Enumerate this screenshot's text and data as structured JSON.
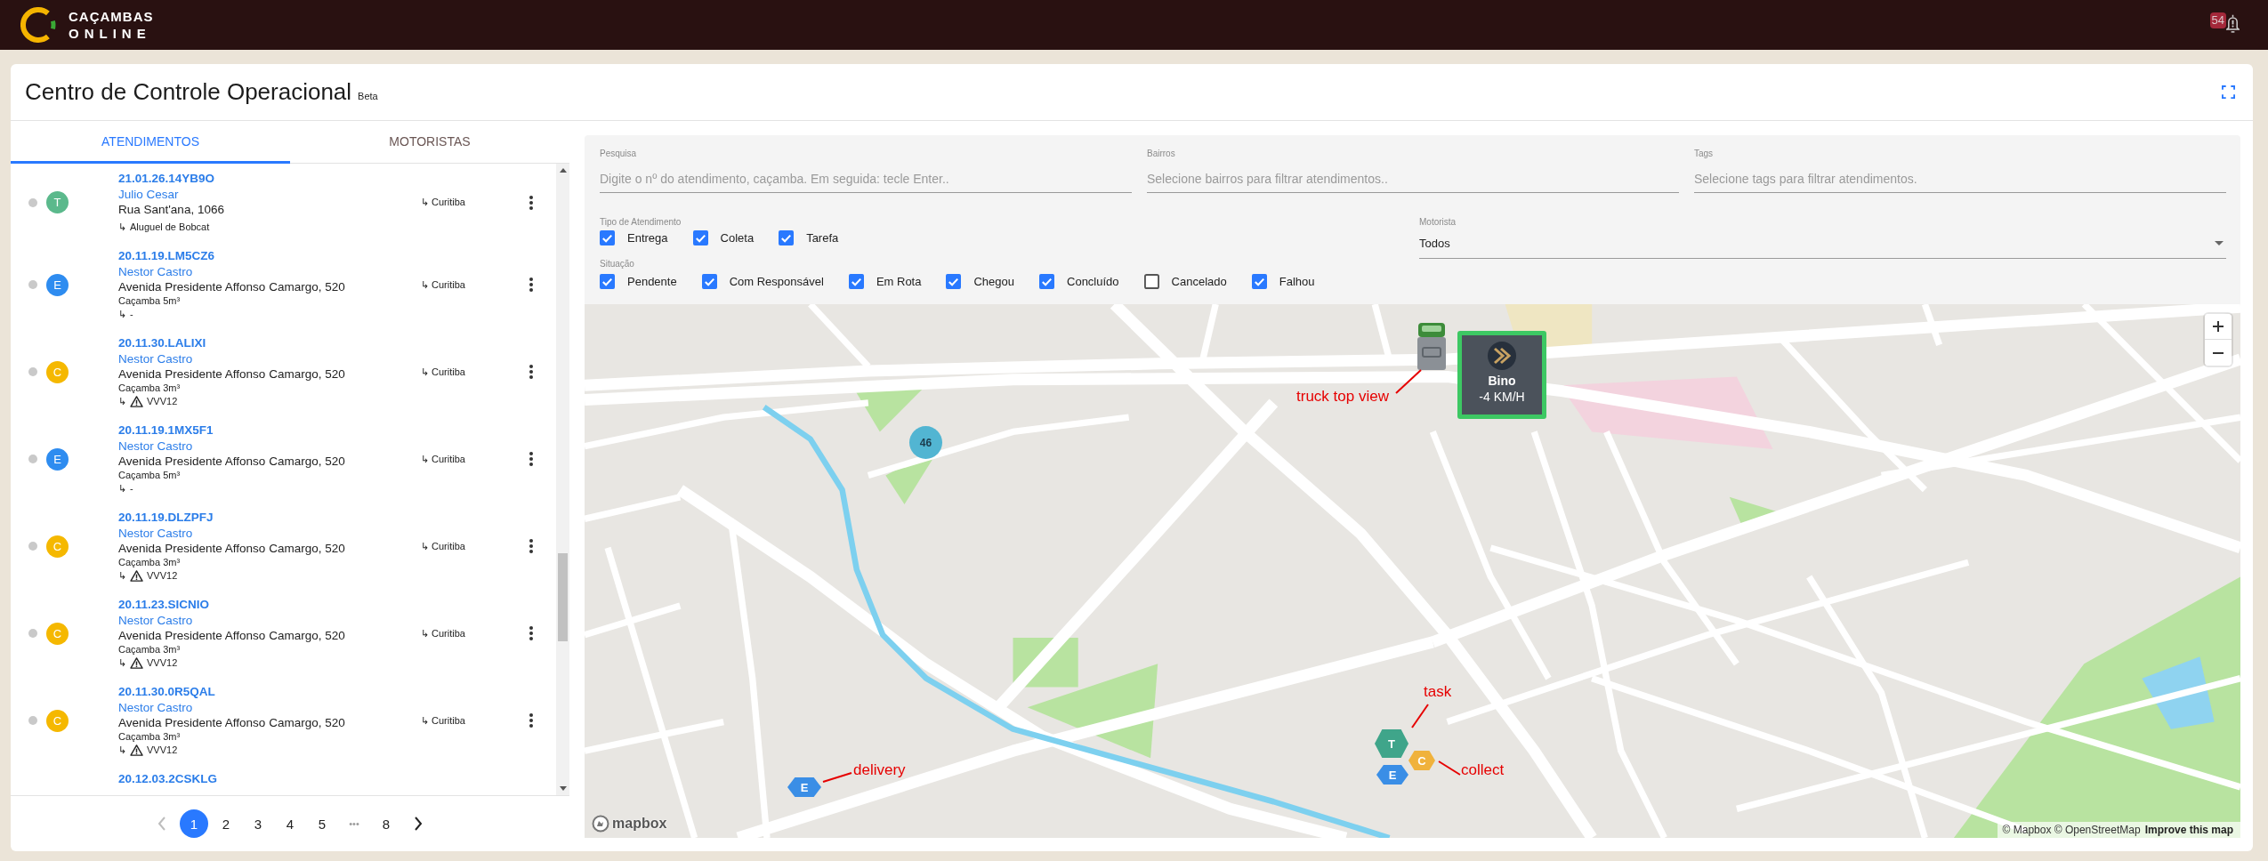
{
  "top_bar": {
    "logo_lines": [
      "CAÇAMBAS",
      "ONLINE"
    ],
    "notification_count": "54"
  },
  "header": {
    "title": "Centro de Controle Operacional",
    "badge": "Beta"
  },
  "left_panel": {
    "tabs": [
      {
        "label": "ATENDIMENTOS",
        "selected": true
      },
      {
        "label": "MOTORISTAS",
        "selected": false
      }
    ],
    "items": [
      {
        "letter": "T",
        "color": "#5bb98c",
        "code": "21.01.26.14YB9O",
        "name": "Julio Cesar",
        "address": "Rua Sant'ana, 1066",
        "detail": {
          "arrow": "↳",
          "warning": false,
          "text": "Aluguel de Bobcat"
        },
        "region": "↳ Curitiba"
      },
      {
        "letter": "E",
        "color": "#2e8cf0",
        "code": "20.11.19.LM5CZ6",
        "name": "Nestor Castro",
        "address": "Avenida Presidente Affonso Camargo, 520",
        "container": "Caçamba 5m³",
        "detail": {
          "arrow": "↳",
          "warning": false,
          "text": "-"
        },
        "region": "↳ Curitiba"
      },
      {
        "letter": "C",
        "color": "#f5b800",
        "code": "20.11.30.LALIXI",
        "name": "Nestor Castro",
        "address": "Avenida Presidente Affonso Camargo, 520",
        "container": "Caçamba 3m³",
        "detail": {
          "arrow": "↳",
          "warning": true,
          "text": "VVV12"
        },
        "region": "↳ Curitiba"
      },
      {
        "letter": "E",
        "color": "#2e8cf0",
        "code": "20.11.19.1MX5F1",
        "name": "Nestor Castro",
        "address": "Avenida Presidente Affonso Camargo, 520",
        "container": "Caçamba 5m³",
        "detail": {
          "arrow": "↳",
          "warning": false,
          "text": "-"
        },
        "region": "↳ Curitiba"
      },
      {
        "letter": "C",
        "color": "#f5b800",
        "code": "20.11.19.DLZPFJ",
        "name": "Nestor Castro",
        "address": "Avenida Presidente Affonso Camargo, 520",
        "container": "Caçamba 3m³",
        "detail": {
          "arrow": "↳",
          "warning": true,
          "text": "VVV12"
        },
        "region": "↳ Curitiba"
      },
      {
        "letter": "C",
        "color": "#f5b800",
        "code": "20.11.23.SICNIO",
        "name": "Nestor Castro",
        "address": "Avenida Presidente Affonso Camargo, 520",
        "container": "Caçamba 3m³",
        "detail": {
          "arrow": "↳",
          "warning": true,
          "text": "VVV12"
        },
        "region": "↳ Curitiba"
      },
      {
        "letter": "C",
        "color": "#f5b800",
        "code": "20.11.30.0R5QAL",
        "name": "Nestor Castro",
        "address": "Avenida Presidente Affonso Camargo, 520",
        "container": "Caçamba 3m³",
        "detail": {
          "arrow": "↳",
          "warning": true,
          "text": "VVV12"
        },
        "region": "↳ Curitiba"
      },
      {
        "code": "20.12.03.2CSKLG"
      }
    ],
    "pagination": {
      "prev": {
        "disabled": true
      },
      "pages": [
        {
          "kind": "page",
          "label": "1",
          "selected": true
        },
        {
          "kind": "page",
          "label": "2",
          "selected": false
        },
        {
          "kind": "page",
          "label": "3",
          "selected": false
        },
        {
          "kind": "page",
          "label": "4",
          "selected": false
        },
        {
          "kind": "page",
          "label": "5",
          "selected": false
        },
        {
          "kind": "ellipsis",
          "label": "•••",
          "selected": false
        },
        {
          "kind": "page",
          "label": "8",
          "selected": false
        }
      ],
      "next": {
        "disabled": false
      }
    }
  },
  "filters": {
    "fields": [
      {
        "label": "Pesquisa",
        "placeholder": "Digite o nº do atendimento, caçamba. Em seguida: tecle Enter.."
      },
      {
        "label": "Bairros",
        "placeholder": "Selecione bairros para filtrar atendimentos.."
      },
      {
        "label": "Tags",
        "placeholder": "Selecione tags para filtrar atendimentos."
      }
    ],
    "type_group": {
      "label": "Tipo de Atendimento",
      "options": [
        {
          "label": "Entrega",
          "checked": true
        },
        {
          "label": "Coleta",
          "checked": true
        },
        {
          "label": "Tarefa",
          "checked": true
        }
      ]
    },
    "driver": {
      "label": "Motorista",
      "value": "Todos"
    },
    "status_group": {
      "label": "Situação",
      "options": [
        {
          "label": "Pendente",
          "checked": true
        },
        {
          "label": "Com Responsável",
          "checked": true
        },
        {
          "label": "Em Rota",
          "checked": true
        },
        {
          "label": "Chegou",
          "checked": true
        },
        {
          "label": "Concluído",
          "checked": true
        },
        {
          "label": "Cancelado",
          "checked": false
        },
        {
          "label": "Falhou",
          "checked": true
        }
      ]
    }
  },
  "map": {
    "cluster": {
      "count": "46"
    },
    "vehicle": {
      "name": "Bino",
      "speed": "-4 KM/H"
    },
    "markers": [
      {
        "letter": "T",
        "color": "#3fa58a"
      },
      {
        "letter": "C",
        "color": "#f0b23c"
      },
      {
        "letter": "E",
        "color": "#3a8ee6"
      },
      {
        "letter": "E",
        "color": "#3a8ee6"
      }
    ],
    "annotations": [
      "truck top view",
      "task",
      "delivery",
      "collect"
    ],
    "logo": "mapbox",
    "attribution": "© Mapbox © OpenStreetMap",
    "attribution_link": "Improve this map"
  }
}
